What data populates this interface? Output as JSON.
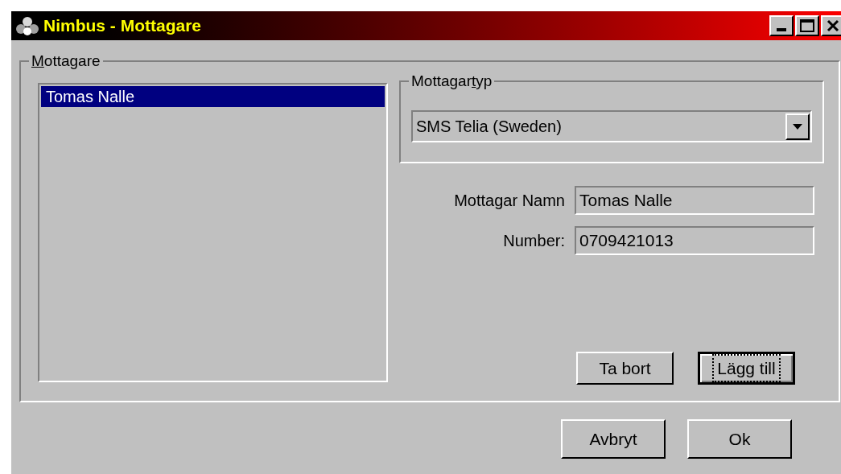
{
  "window": {
    "title": "Nimbus - Mottagare"
  },
  "recipients_group": {
    "label_parts": {
      "key": "M",
      "after": "ottagare"
    },
    "items": [
      {
        "label": "Tomas Nalle",
        "selected": true
      }
    ]
  },
  "type_group": {
    "label_parts": {
      "before": "Mottagar",
      "key": "t",
      "after": "yp"
    },
    "value": "SMS Telia (Sweden)"
  },
  "fields": [
    {
      "label": "Mottagar Namn",
      "value": "Tomas Nalle"
    },
    {
      "label": "Number:",
      "value": "0709421013"
    }
  ],
  "list_buttons": [
    {
      "label": "Ta bort",
      "focused": false
    },
    {
      "label": "Lägg till",
      "focused": true
    }
  ],
  "dialog_buttons": [
    {
      "label": "Avbryt",
      "focused": false
    },
    {
      "label": "Ok",
      "focused": false
    }
  ]
}
